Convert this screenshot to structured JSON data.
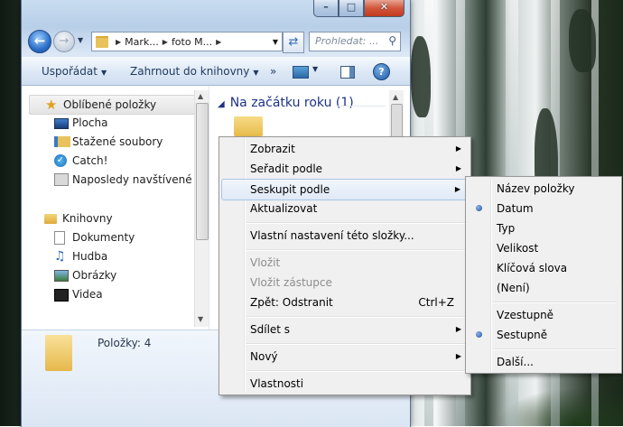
{
  "window": {
    "caption_buttons": {
      "minimize": "–",
      "maximize": "□",
      "close": "✕"
    },
    "address": {
      "crumbs": [
        "Mark...",
        "foto M..."
      ]
    },
    "search_placeholder": "Prohledat: ...",
    "toolbar": {
      "organize": "Uspořádat",
      "include": "Zahrnout do knihovny",
      "more": "»"
    },
    "nav": {
      "favorites_header": "Oblíbené položky",
      "favorites": [
        {
          "label": "Plocha",
          "icon": "desktop-icon"
        },
        {
          "label": "Stažené soubory",
          "icon": "downloads-icon"
        },
        {
          "label": "Catch!",
          "icon": "catch-icon"
        },
        {
          "label": "Naposledy navštívené",
          "icon": "recent-icon"
        }
      ],
      "libraries_header": "Knihovny",
      "libraries": [
        {
          "label": "Dokumenty",
          "icon": "documents-icon"
        },
        {
          "label": "Hudba",
          "icon": "music-icon"
        },
        {
          "label": "Obrázky",
          "icon": "pictures-icon"
        },
        {
          "label": "Videa",
          "icon": "videos-icon"
        }
      ]
    },
    "group_header": "Na začátku roku (1)",
    "details": {
      "count": "Položky: 4"
    }
  },
  "context_menu": {
    "items": [
      {
        "label": "Zobrazit",
        "submenu": true
      },
      {
        "label": "Seřadit podle",
        "submenu": true
      },
      {
        "label": "Seskupit podle",
        "submenu": true,
        "highlighted": true
      },
      {
        "label": "Aktualizovat"
      },
      {
        "label": "Vlastní nastavení této složky..."
      },
      {
        "label": "Vložit",
        "disabled": true
      },
      {
        "label": "Vložit zástupce",
        "disabled": true
      },
      {
        "label": "Zpět: Odstranit",
        "shortcut": "Ctrl+Z"
      },
      {
        "label": "Sdílet s",
        "submenu": true
      },
      {
        "label": "Nový",
        "submenu": true
      },
      {
        "label": "Vlastnosti"
      }
    ]
  },
  "group_submenu": {
    "items": [
      {
        "label": "Název položky"
      },
      {
        "label": "Datum",
        "selected": true
      },
      {
        "label": "Typ"
      },
      {
        "label": "Velikost"
      },
      {
        "label": "Klíčová slova"
      },
      {
        "label": "(Není)"
      },
      {
        "label": "Vzestupně"
      },
      {
        "label": "Sestupně",
        "selected": true
      },
      {
        "label": "Další..."
      }
    ]
  },
  "colors": {
    "accent": "#1e3287",
    "highlight_border": "#a9c5e5",
    "menu_bg": "#f0f0f0"
  }
}
